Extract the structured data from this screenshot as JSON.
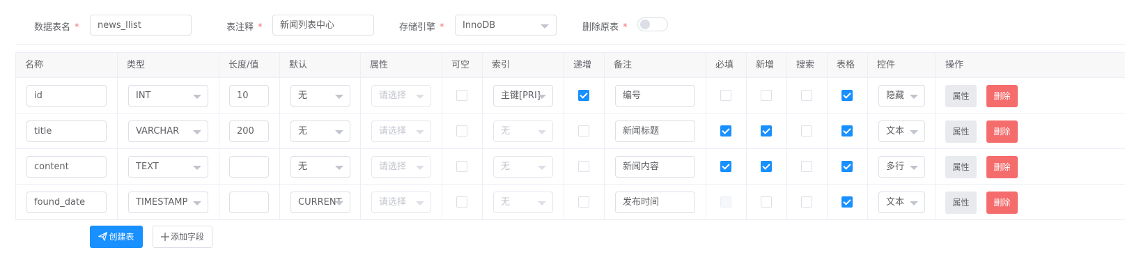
{
  "form": {
    "table_name": {
      "label": "数据表名",
      "required_mark": "*",
      "value": "news_llist"
    },
    "table_comment": {
      "label": "表注释",
      "required_mark": "*",
      "value": "新闻列表中心"
    },
    "engine": {
      "label": "存储引擎",
      "required_mark": "*",
      "value": "InnoDB"
    },
    "drop_original": {
      "label": "删除原表",
      "required_mark": "*",
      "on": false
    }
  },
  "table": {
    "headers": [
      "名称",
      "类型",
      "长度/值",
      "默认",
      "属性",
      "可空",
      "索引",
      "递增",
      "备注",
      "必填",
      "新增",
      "搜索",
      "表格",
      "控件",
      "操作"
    ],
    "rows": [
      {
        "name": "id",
        "type": "INT",
        "length": "10",
        "default": "无",
        "attr": "请选择",
        "nullable": false,
        "index": "主键[PRI]",
        "index_disabled": false,
        "auto_inc": true,
        "comment": "编号",
        "required": false,
        "required_disabled": false,
        "add": false,
        "search": false,
        "list": true,
        "control": "隐藏"
      },
      {
        "name": "title",
        "type": "VARCHAR",
        "length": "200",
        "default": "无",
        "attr": "请选择",
        "nullable": false,
        "index": "无",
        "index_disabled": true,
        "auto_inc": false,
        "comment": "新闻标题",
        "required": true,
        "required_disabled": false,
        "add": true,
        "search": false,
        "list": true,
        "control": "文本"
      },
      {
        "name": "content",
        "type": "TEXT",
        "length": "",
        "default": "无",
        "attr": "请选择",
        "nullable": false,
        "index": "无",
        "index_disabled": true,
        "auto_inc": false,
        "comment": "新闻内容",
        "required": true,
        "required_disabled": false,
        "add": true,
        "search": false,
        "list": true,
        "control": "多行"
      },
      {
        "name": "found_date",
        "type": "TIMESTAMP",
        "length": "",
        "default": "CURRENT",
        "attr": "请选择",
        "nullable": false,
        "index": "无",
        "index_disabled": true,
        "auto_inc": false,
        "comment": "发布时间",
        "required": false,
        "required_disabled": true,
        "add": false,
        "search": false,
        "list": true,
        "control": "文本"
      }
    ],
    "btn_attr": "属性",
    "btn_delete": "删除"
  },
  "footer": {
    "create_label": "创建表",
    "add_field_label": "添加字段"
  },
  "colors": {
    "primary": "#1890ff",
    "danger": "#f56c6c",
    "border": "#dcdfe6"
  },
  "icons": {
    "create": "paper-plane-icon",
    "add": "plus-icon",
    "select": "caret-down-icon"
  }
}
